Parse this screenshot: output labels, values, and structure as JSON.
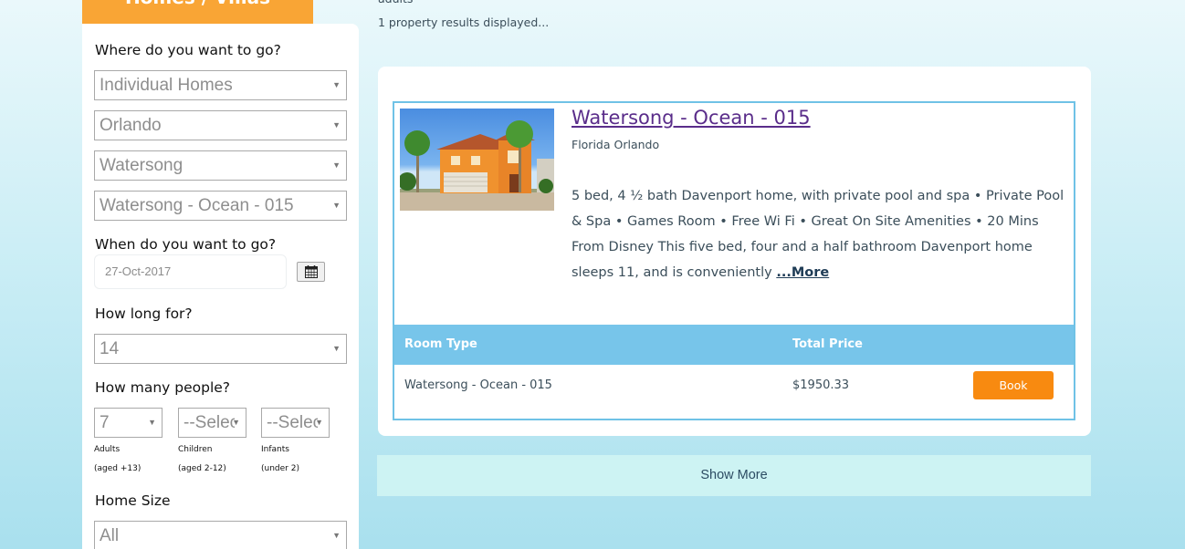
{
  "header": {
    "tab_title": "Homes / Villas"
  },
  "search": {
    "destination_label": "Where do you want to go?",
    "property_type": "Individual Homes",
    "city": "Orlando",
    "resort": "Watersong",
    "property": "Watersong - Ocean - 015",
    "date_label": "When do you want to go?",
    "date_value": "27-Oct-2017",
    "duration_label": "How long for?",
    "duration_value": "14",
    "people_label": "How many people?",
    "adults_value": "7",
    "children_value": "--Select--",
    "infants_value": "--Select--",
    "adults_label": "Adults",
    "adults_sub": "(aged +13)",
    "children_label": "Children",
    "children_sub": "(aged 2-12)",
    "infants_label": "Infants",
    "infants_sub": "(under 2)",
    "size_label": "Home Size",
    "size_value": "All"
  },
  "results": {
    "cut_text": "adults",
    "count_text": "1 property results displayed...",
    "listing": {
      "title": "Watersong - Ocean - 015",
      "location": "Florida Orlando",
      "description": "5 bed, 4 ½ bath Davenport home, with private pool and spa • Private Pool & Spa • Games Room • Free Wi Fi • Great On Site Amenities • 20 Mins From Disney This five bed, four and a half bathroom Davenport home sleeps 11, and is conveniently ",
      "more_link": "...More",
      "table": {
        "col_room_type": "Room Type",
        "col_total_price": "Total Price",
        "room_type": "Watersong - Ocean - 015",
        "total_price": "$1950.33",
        "book_label": "Book"
      }
    },
    "show_more_label": "Show More"
  },
  "icons": {
    "dropdown": "chevron-down-icon",
    "calendar": "calendar-icon"
  },
  "colors": {
    "accent_orange": "#f9a535",
    "book_orange": "#f88a10",
    "table_header_blue": "#77c5ea",
    "title_purple": "#5a2d8a"
  }
}
